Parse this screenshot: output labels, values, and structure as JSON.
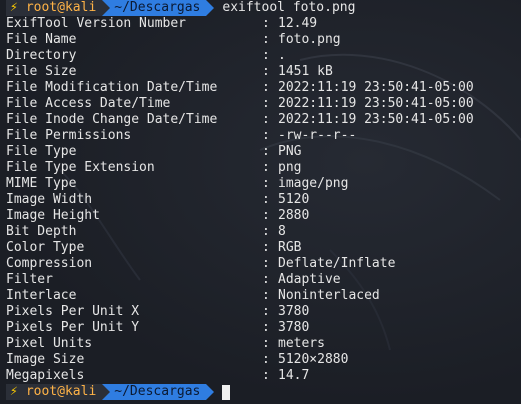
{
  "prompt": {
    "bolt": "⚡",
    "user_host": "root@kali",
    "directory": "~/Descargas",
    "command": "exiftool foto.png"
  },
  "rows": [
    {
      "key": "ExifTool Version Number",
      "value": "12.49"
    },
    {
      "key": "File Name",
      "value": "foto.png"
    },
    {
      "key": "Directory",
      "value": "."
    },
    {
      "key": "File Size",
      "value": "1451 kB"
    },
    {
      "key": "File Modification Date/Time",
      "value": "2022:11:19 23:50:41-05:00"
    },
    {
      "key": "File Access Date/Time",
      "value": "2022:11:19 23:50:41-05:00"
    },
    {
      "key": "File Inode Change Date/Time",
      "value": "2022:11:19 23:50:41-05:00"
    },
    {
      "key": "File Permissions",
      "value": "-rw-r--r--"
    },
    {
      "key": "File Type",
      "value": "PNG"
    },
    {
      "key": "File Type Extension",
      "value": "png"
    },
    {
      "key": "MIME Type",
      "value": "image/png"
    },
    {
      "key": "Image Width",
      "value": "5120"
    },
    {
      "key": "Image Height",
      "value": "2880"
    },
    {
      "key": "Bit Depth",
      "value": "8"
    },
    {
      "key": "Color Type",
      "value": "RGB"
    },
    {
      "key": "Compression",
      "value": "Deflate/Inflate"
    },
    {
      "key": "Filter",
      "value": "Adaptive"
    },
    {
      "key": "Interlace",
      "value": "Noninterlaced"
    },
    {
      "key": "Pixels Per Unit X",
      "value": "3780"
    },
    {
      "key": "Pixels Per Unit Y",
      "value": "3780"
    },
    {
      "key": "Pixel Units",
      "value": "meters"
    },
    {
      "key": "Image Size",
      "value": "5120×2880"
    },
    {
      "key": "Megapixels",
      "value": "14.7"
    }
  ],
  "separator": ":",
  "final_prompt": {
    "bolt": "⚡",
    "user_host": "root@kali",
    "directory": "~/Descargas"
  }
}
